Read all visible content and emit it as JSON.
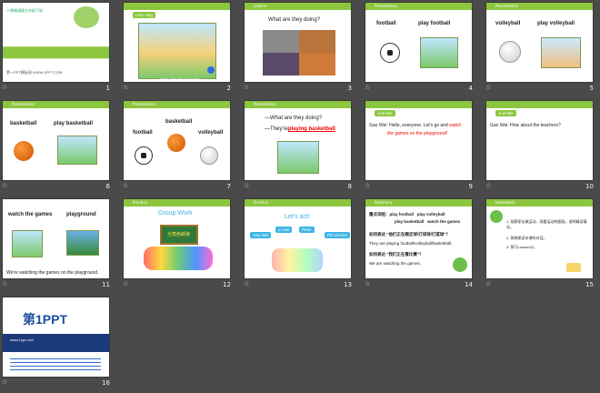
{
  "slides": [
    {
      "num": "1",
      "title_small": "人教精通版五年级下册",
      "title": "Unit 6 We're watching the games.",
      "footer": "第一PPT模板网-WWW.1PPT.COM"
    },
    {
      "num": "2",
      "tag": "Let's sing",
      "caption": "We're doing the hokey pokey"
    },
    {
      "num": "3",
      "header": "Lead-in",
      "text": "What are they doing?"
    },
    {
      "num": "4",
      "header": "Presentation",
      "w1": "football",
      "w2": "play football"
    },
    {
      "num": "5",
      "header": "Presentation",
      "w1": "volleyball",
      "w2": "play volleyball"
    },
    {
      "num": "6",
      "header": "Presentation",
      "w1": "basketball",
      "w2": "play basketball"
    },
    {
      "num": "7",
      "header": "Presentation",
      "w1": "basketball",
      "w2": "football",
      "w3": "volleyball"
    },
    {
      "num": "8",
      "header": "Presentation",
      "l1": "—What are they doing?",
      "l2": "—They're",
      "l2b": "playing basketball",
      "l2c": "."
    },
    {
      "num": "9",
      "tag": "Just talk",
      "l1": "Gao Wei: Hello, everyone.  Let's go and",
      "l1b": "watch",
      "l2": "the games on the playground!"
    },
    {
      "num": "10",
      "tag": "Just talk",
      "l1": "Gao Wei: How about the teachers?"
    },
    {
      "num": "11",
      "w1": "watch the games",
      "w2": "playground",
      "l1": "We're watching the games on the playground."
    },
    {
      "num": "12",
      "header": "Practice",
      "title": "Group Work",
      "board": "分角色朗读"
    },
    {
      "num": "13",
      "header": "Practice",
      "title": "Let's act!",
      "n1": "Gao Wei",
      "n2": "Li Yan",
      "n3": "Peter",
      "n4": "PE teacher"
    },
    {
      "num": "14",
      "header": "Summary",
      "l1": "重点词组：play football",
      "l1b": "play volleyball",
      "l2": "play basketball",
      "l2b": "watch the games",
      "q1": "如何表达 \"他们正在踢足球/打排球/打篮球\"？",
      "a1": "They are playing football/volleyball/basketball.",
      "q2": "如何表达 \"我们正在看比赛\"？",
      "a2": "We are watching the games."
    },
    {
      "num": "15",
      "header": "Homework",
      "h1": "1. 观察家长做运动、观看运动的图画，说明精读情况。",
      "h2": "2. 熟练朗读本课的对话。",
      "h3": "3. 预习Lesson32。"
    },
    {
      "num": "16",
      "brand": "第1PPT",
      "sub": "www.1ppt.com"
    }
  ]
}
